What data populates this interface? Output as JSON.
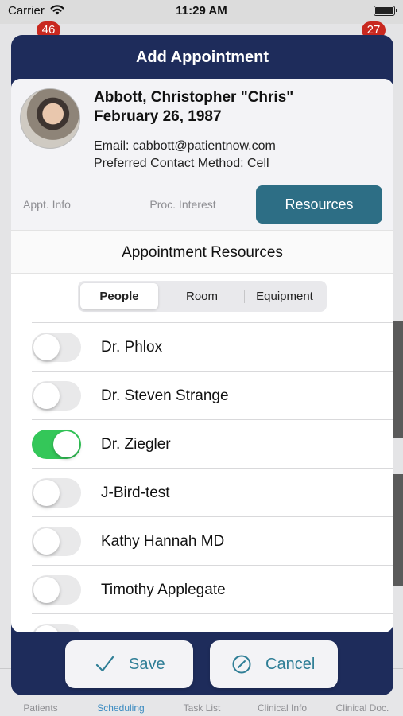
{
  "status_bar": {
    "carrier": "Carrier",
    "time": "11:29 AM"
  },
  "background": {
    "badges": [
      "46",
      "27"
    ],
    "tabbar": [
      "Patients",
      "Scheduling",
      "Task List",
      "Clinical Info",
      "Clinical Doc."
    ],
    "active_tab": "Scheduling"
  },
  "modal": {
    "title": "Add Appointment",
    "patient": {
      "name": "Abbott, Christopher \"Chris\"",
      "dob": "February 26, 1987",
      "email": "Email: cabbott@patientnow.com",
      "contact": "Preferred Contact Method: Cell"
    },
    "tabs": [
      {
        "label": "Appt. Info",
        "active": false
      },
      {
        "label": "Proc. Interest",
        "active": false
      },
      {
        "label": "Resources",
        "active": true
      }
    ],
    "section_title": "Appointment Resources",
    "segments": [
      {
        "label": "People",
        "active": true
      },
      {
        "label": "Room",
        "active": false
      },
      {
        "label": "Equipment",
        "active": false
      }
    ],
    "resources": [
      {
        "name": "Dr. Phlox",
        "enabled": false
      },
      {
        "name": "Dr. Steven Strange",
        "enabled": false
      },
      {
        "name": "Dr. Ziegler",
        "enabled": true
      },
      {
        "name": "J-Bird-test",
        "enabled": false
      },
      {
        "name": "Kathy Hannah MD",
        "enabled": false
      },
      {
        "name": "Timothy Applegate",
        "enabled": false
      }
    ],
    "buttons": {
      "save": "Save",
      "cancel": "Cancel"
    }
  },
  "colors": {
    "modal_header": "#1e2c5b",
    "accent": "#2d6e85",
    "toggle_on": "#34c759",
    "badge": "#c8281f",
    "button_text": "#2f7e96"
  }
}
